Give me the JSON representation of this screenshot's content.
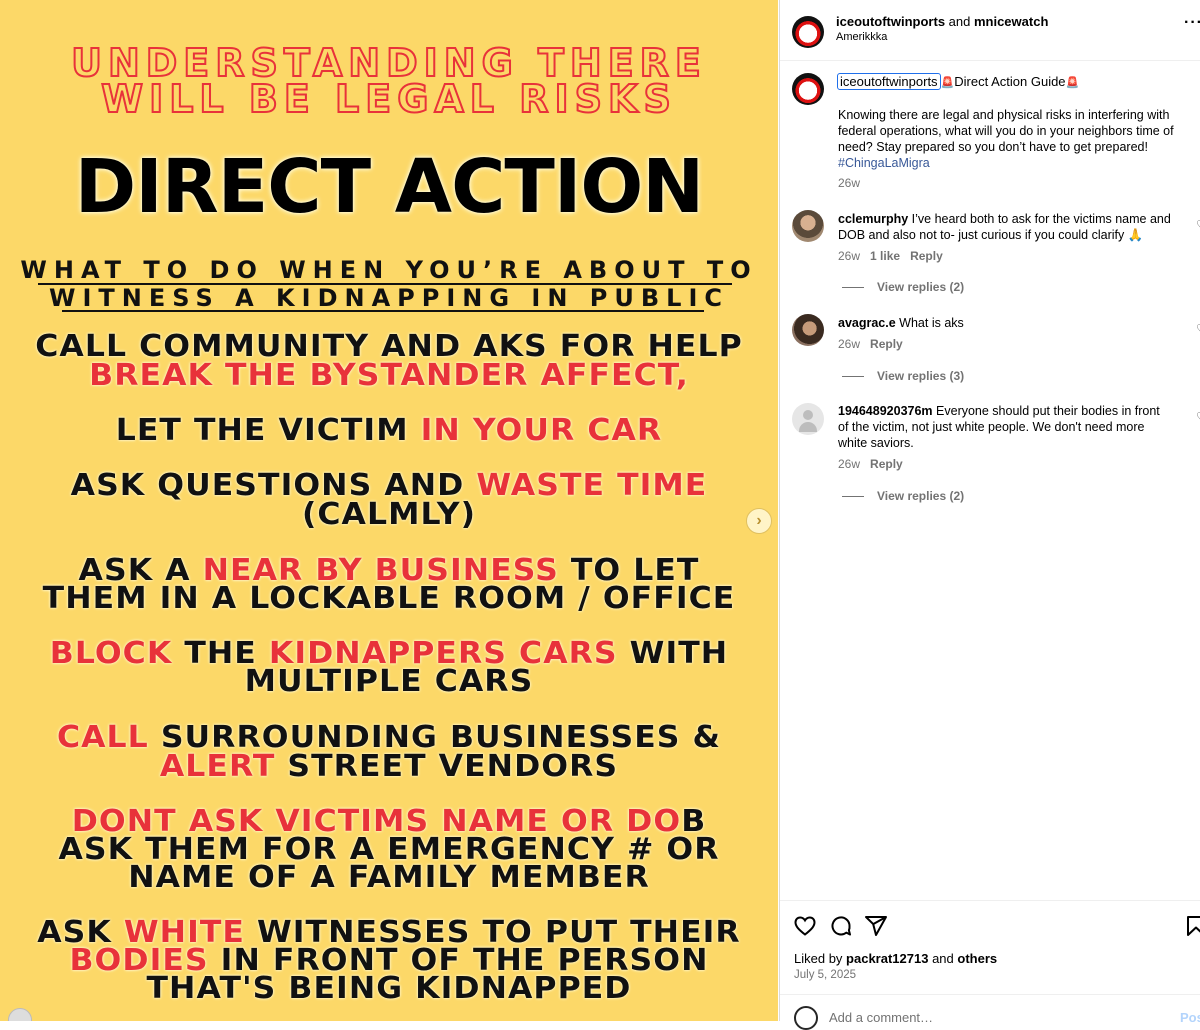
{
  "poster": {
    "title_l1": "UNDERSTANDING THERE",
    "title_l2": "WILL BE LEGAL RISKS",
    "headline": "DIRECT ACTION",
    "sub_l1": "WHAT TO DO WHEN YOU’RE ABOUT TO",
    "sub_l2": "WITNESS A KIDNAPPING IN PUBLIC",
    "t1a": "CALL COMMUNITY AND AKS FOR HELP",
    "t1b": "BREAK THE BYSTANDER AFFECT,",
    "t2a": "LET THE VICTIM ",
    "t2b": "IN YOUR CAR",
    "t3a": "ASK QUESTIONS AND ",
    "t3b": "WASTE TIME",
    "t3c": "(CALMLY)",
    "t4a": "ASK A ",
    "t4b": "NEAR BY BUSINESS",
    "t4c": " TO LET",
    "t4d": "THEM IN A LOCKABLE ROOM / OFFICE",
    "t5a": "BLOCK",
    "t5b": " THE ",
    "t5c": "KIDNAPPERS CARS",
    "t5d": " WITH",
    "t5e": "MULTIPLE CARS",
    "t6a": "CALL",
    "t6b": " SURROUNDING BUSINESSES &",
    "t6c": "ALERT",
    "t6d": " STREET VENDORS",
    "t7a": "DONT ASK VICTIMS NAME OR DO",
    "t7b": "B",
    "t7c": "ASK THEM FOR A EMERGENCY # OR",
    "t7d": "NAME OF A FAMILY MEMBER",
    "t8a": "ASK ",
    "t8b": "WHITE",
    "t8c": " WITNESSES TO PUT THEIR",
    "t8d": "BODIES",
    "t8e": " IN FRONT OF THE PERSON",
    "t8f": "THAT'S BEING KIDNAPPED"
  },
  "header": {
    "user1": "iceoutoftwinports",
    "and": " and ",
    "user2": "mnicewatch",
    "location": "Amerikkka",
    "more_icon": "more-horizontal-icon"
  },
  "caption": {
    "username": "iceoutoftwinports",
    "title": "Direct Action Guide",
    "siren_icon": "🚨",
    "body_l1": "Knowing there are legal and physical risks in interfering with",
    "body_l2": "federal operations, what will you do in your neighbors time of",
    "body_l3": "need? Stay prepared so you don’t have to get prepared!",
    "hashtag": "#ChingaLaMigra",
    "time": "26w"
  },
  "comments": [
    {
      "username": "cclemurphy",
      "text_l1": "I’ve heard both to ask for the victims name and",
      "text_l2": "DOB and also not to- just curious if you could clarify",
      "emoji": "🙏",
      "time": "26w",
      "likes": "1 like",
      "reply": "Reply",
      "view_replies": "View replies (2)"
    },
    {
      "username": "avagrac.e",
      "text_l1": "What is aks",
      "time": "26w",
      "reply": "Reply",
      "view_replies": "View replies (3)"
    },
    {
      "username": "194648920376m",
      "text_l1": "Everyone should put their bodies in front",
      "text_l2": "of the victim, not just white people. We don't need more",
      "text_l3": "white saviors.",
      "time": "26w",
      "reply": "Reply",
      "view_replies": "View replies (2)"
    }
  ],
  "footer": {
    "liked_prefix": "Liked by ",
    "liked_user": "packrat12713",
    "liked_mid": " and ",
    "liked_others": "others",
    "date": "July 5, 2025",
    "comment_placeholder": "Add a comment…",
    "post_label": "Post"
  },
  "colors": {
    "poster_bg": "#fcd868",
    "poster_red": "#e8323a",
    "link_blue": "#385898"
  }
}
